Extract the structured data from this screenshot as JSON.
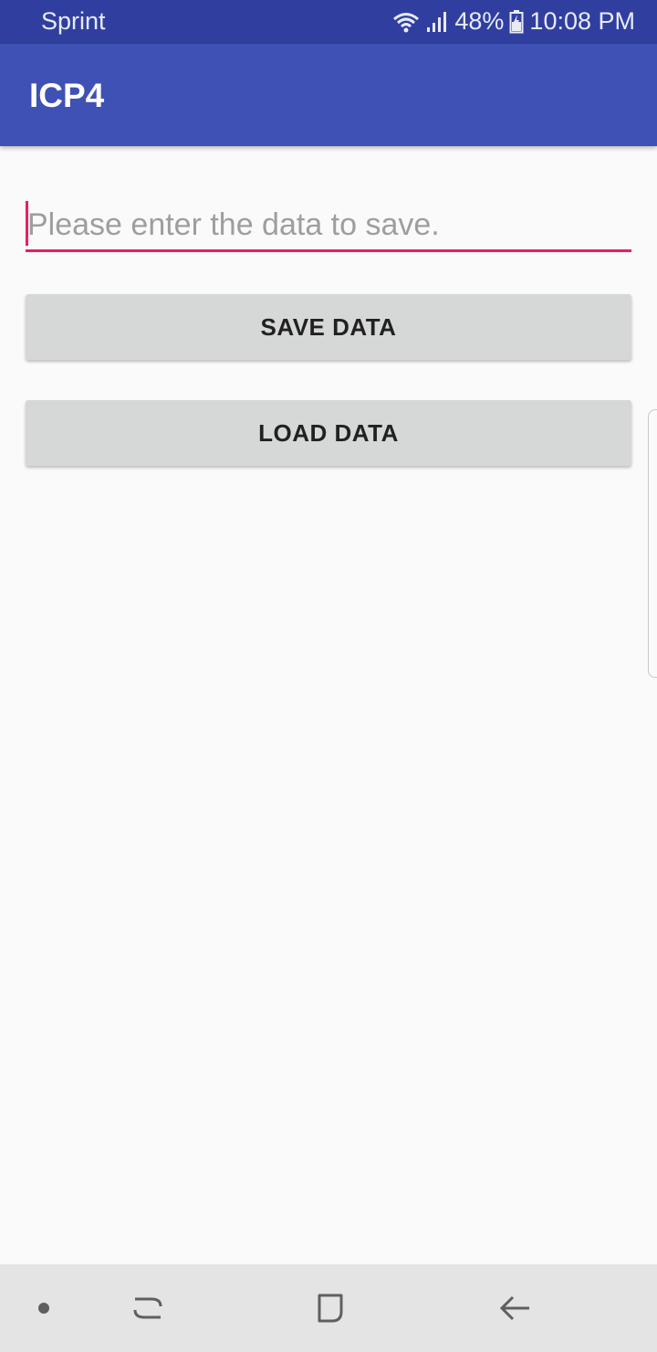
{
  "status_bar": {
    "carrier": "Sprint",
    "battery": "48%",
    "time": "10:08 PM",
    "icons": [
      "wifi-icon",
      "signal-icon",
      "battery-charging-icon"
    ]
  },
  "app_bar": {
    "title": "ICP4",
    "color": "#3f51b5"
  },
  "form": {
    "input": {
      "value": "",
      "placeholder": "Please enter the data to save.",
      "accent": "#e91e63"
    },
    "save_label": "SAVE DATA",
    "load_label": "LOAD DATA"
  },
  "nav_bar": {
    "icons": [
      "dot-icon",
      "recent-apps-icon",
      "home-icon",
      "back-icon"
    ]
  },
  "colors": {
    "status_bar": "#303f9f",
    "primary": "#3f51b5",
    "accent": "#e91e63",
    "button": "#d6d7d7",
    "background": "#fafafa"
  }
}
